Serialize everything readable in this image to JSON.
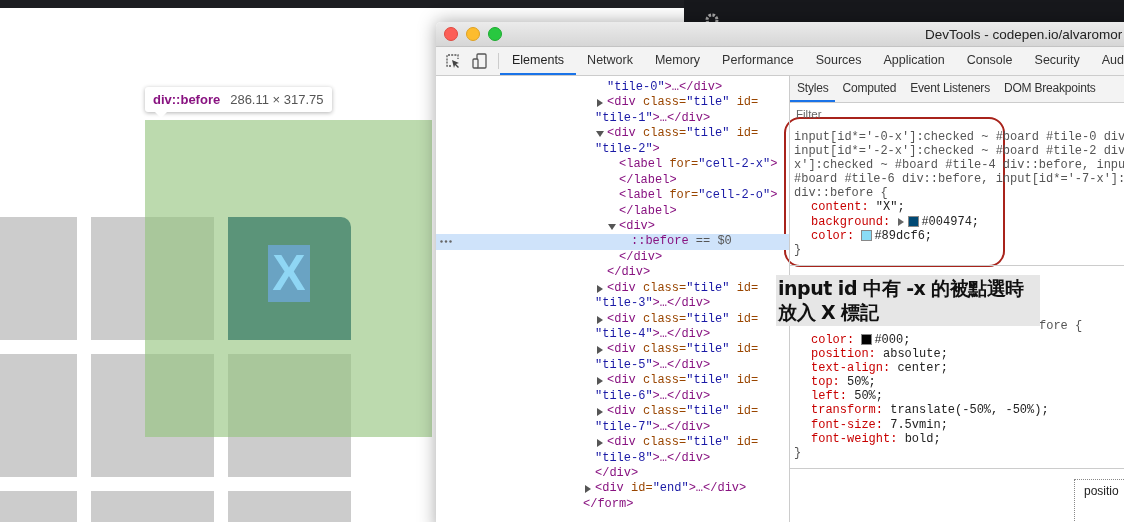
{
  "page": {
    "tiles": [
      {
        "kind": "empty"
      },
      {
        "kind": "empty"
      },
      {
        "kind": "x",
        "text": "X"
      },
      {
        "kind": "empty"
      },
      {
        "kind": "empty"
      },
      {
        "kind": "empty"
      },
      {
        "kind": "empty"
      },
      {
        "kind": "empty"
      },
      {
        "kind": "empty"
      }
    ],
    "highlight": {
      "tag": "div::before",
      "size": "286.11 × 317.75"
    }
  },
  "devtools": {
    "title": "DevTools - codepen.io/alvaromor",
    "tabs": [
      {
        "label": "Elements",
        "selected": true
      },
      {
        "label": "Network",
        "selected": false
      },
      {
        "label": "Memory",
        "selected": false
      },
      {
        "label": "Performance",
        "selected": false
      },
      {
        "label": "Sources",
        "selected": false
      },
      {
        "label": "Application",
        "selected": false
      },
      {
        "label": "Console",
        "selected": false
      },
      {
        "label": "Security",
        "selected": false
      },
      {
        "label": "Aud",
        "selected": false
      }
    ],
    "dom_tree": [
      {
        "children": [
          {
            "children": [
              {
                "lines": [
                  "\"tile-0\">…</div>"
                ]
              },
              {
                "lines": [
                  "<div class=\"tile\" id=",
                  "\"tile-1\">…</div>"
                ],
                "expanded": false
              },
              {
                "lines": [
                  "<div class=\"tile\" id=",
                  "\"tile-2\">"
                ],
                "expanded": true,
                "children": [
                  {
                    "lines": [
                      "<label for=\"cell-2-x\">"
                    ],
                    "close": "</label>"
                  },
                  {
                    "lines": [
                      "<label for=\"cell-2-o\">"
                    ],
                    "close": "</label>"
                  },
                  {
                    "lines": [
                      "<div>"
                    ],
                    "expanded": true,
                    "children": [
                      {
                        "lines": [
                          "::before == $0"
                        ],
                        "selected": true
                      }
                    ],
                    "close": "</div>"
                  }
                ],
                "close": "</div>"
              },
              {
                "lines": [
                  "<div class=\"tile\" id=",
                  "\"tile-3\">…</div>"
                ],
                "expanded": false
              },
              {
                "lines": [
                  "<div class=\"tile\" id=",
                  "\"tile-4\">…</div>"
                ],
                "expanded": false
              },
              {
                "lines": [
                  "<div class=\"tile\" id=",
                  "\"tile-5\">…</div>"
                ],
                "expanded": false
              },
              {
                "lines": [
                  "<div class=\"tile\" id=",
                  "\"tile-6\">…</div>"
                ],
                "expanded": false
              },
              {
                "lines": [
                  "<div class=\"tile\" id=",
                  "\"tile-7\">…</div>"
                ],
                "expanded": false
              },
              {
                "lines": [
                  "<div class=\"tile\" id=",
                  "\"tile-8\">…</div>"
                ],
                "expanded": false
              }
            ],
            "close": "</div>"
          },
          {
            "lines": [
              "<div id=\"end\">…</div>"
            ],
            "expanded": false
          }
        ],
        "close": "</form>"
      }
    ],
    "style_tabs": [
      {
        "label": "Styles",
        "selected": true
      },
      {
        "label": "Computed",
        "selected": false
      },
      {
        "label": "Event Listeners",
        "selected": false
      },
      {
        "label": "DOM Breakpoints",
        "selected": false
      }
    ],
    "filter": {
      "placeholder": "Filter"
    },
    "rules": [
      {
        "selector_lines": [
          "input[id*='-0-x']:checked ~ #board #tile-0 div",
          "input[id*='-2-x']:checked ~ #board #tile-2 div",
          "x']:checked ~ #board #tile-4 div::before, inpu",
          "#board #tile-6 div::before, input[id*='-7-x']:",
          "div::before {"
        ],
        "declarations": [
          {
            "name": "content:",
            "value": "\"X\";"
          },
          {
            "name": "background:",
            "value": "#004974;",
            "color": "#004974",
            "expandable": true
          },
          {
            "name": "color:",
            "value": "#89dcf6;",
            "color": "#89dcf6"
          }
        ],
        "close": "}"
      },
      {
        "selector_lines": [
          "fore {"
        ],
        "declarations": [
          {
            "name": "color:",
            "value": "#000;",
            "color": "#000000"
          },
          {
            "name": "position:",
            "value": "absolute;"
          },
          {
            "name": "text-align:",
            "value": "center;"
          },
          {
            "name": "top:",
            "value": "50%;"
          },
          {
            "name": "left:",
            "value": "50%;"
          },
          {
            "name": "transform:",
            "value": "translate(-50%, -50%);"
          },
          {
            "name": "font-size:",
            "value": "7.5vmin;"
          },
          {
            "name": "font-weight:",
            "value": "bold;"
          }
        ],
        "close": "}"
      }
    ],
    "annotation": {
      "lines": [
        "input id 中有 -x 的被點選時",
        "放入 X 標記"
      ]
    },
    "box_model": {
      "label": "positio"
    }
  }
}
